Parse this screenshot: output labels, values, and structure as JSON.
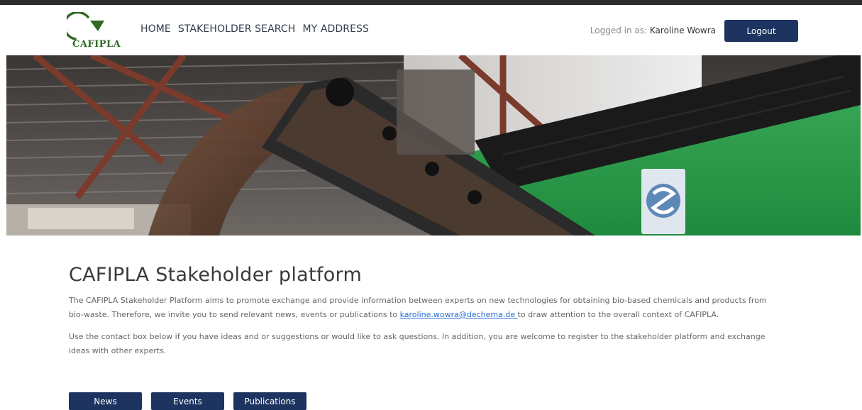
{
  "brand": {
    "logo_text": "CAFIPLA",
    "logo_icon": "circular-arrow-icon",
    "accent_color": "#2e6a24"
  },
  "nav": {
    "items": [
      {
        "label": "HOME"
      },
      {
        "label": "STAKEHOLDER SEARCH"
      },
      {
        "label": "MY ADDRESS"
      }
    ]
  },
  "session": {
    "logged_in_prefix": "Logged in as: ",
    "user_name": "Karoline Wowra",
    "logout_label": "Logout"
  },
  "hero": {
    "image_description_icon": "conveyor-photo",
    "primary_color": "#1d3461"
  },
  "main": {
    "title": "CAFIPLA Stakeholder platform",
    "paragraph1_line1": "The CAFIPLA Stakeholder Platform aims to promote exchange and provide information between experts on new technologies for obtaining bio-based chemicals and products from",
    "paragraph1_line2_before": "bio-waste. Therefore, we invite you to send relevant news, events or publications to ",
    "email": "karoline.wowra@dechema.de ",
    "paragraph1_line2_after": " to draw attention to the overall context of CAFIPLA.",
    "paragraph2_line1": "Use the contact box below if you have ideas and or suggestions or would like to ask questions. In addition, you are welcome to register to the stakeholder platform and exchange",
    "paragraph2_line2": "ideas with other experts."
  },
  "tabs": [
    {
      "label": "News"
    },
    {
      "label": "Events"
    },
    {
      "label": "Publications"
    }
  ]
}
